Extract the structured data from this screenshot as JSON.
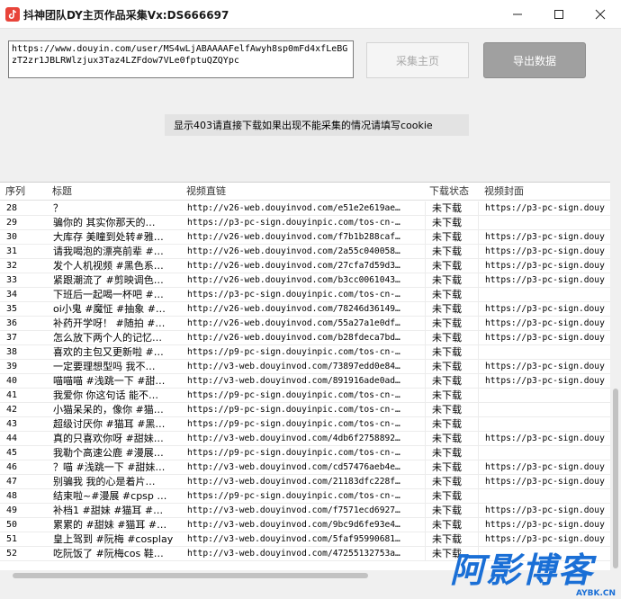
{
  "window": {
    "title": "抖神团队DY主页作品采集Vx:DS666697",
    "icon": "app-logo-icon"
  },
  "controls": {
    "url_value": "https://www.douyin.com/user/MS4wLjABAAAAFelfAwyh8sp0mFd4xfLeBGzT2zr1JBLRWlzjux3Taz4LZFdow7VLe0fptuQZQYpc",
    "collect_button": "采集主页",
    "export_button": "导出数据",
    "notice": "显示403请直接下载如果出现不能采集的情况请填写cookie"
  },
  "table": {
    "columns": [
      "序列",
      "标题",
      "视频直链",
      "下载状态",
      "视频封面"
    ],
    "rows": [
      {
        "idx": "28",
        "title": "？",
        "link": "http://v26-web.douyinvod.com/e51e2e619ae…",
        "status": "未下载",
        "cover": "https://p3-pc-sign.douy"
      },
      {
        "idx": "29",
        "title": "骗你的 其实你那天的…",
        "link": "https://p3-pc-sign.douyinpic.com/tos-cn-…",
        "status": "未下载",
        "cover": ""
      },
      {
        "idx": "30",
        "title": "大库存 美瞳到处转#雅…",
        "link": "http://v26-web.douyinvod.com/f7b1b288caf…",
        "status": "未下载",
        "cover": "https://p3-pc-sign.douy"
      },
      {
        "idx": "31",
        "title": "请我喝泡的漂亮前辈 #…",
        "link": "http://v26-web.douyinvod.com/2a55c040058…",
        "status": "未下载",
        "cover": "https://p3-pc-sign.douy"
      },
      {
        "idx": "32",
        "title": "发个人机视频 #黑色系…",
        "link": "http://v26-web.douyinvod.com/27cfa7d59d3…",
        "status": "未下载",
        "cover": "https://p3-pc-sign.douy"
      },
      {
        "idx": "33",
        "title": "紧跟潮流了 #剪映调色…",
        "link": "http://v26-web.douyinvod.com/b3cc0061043…",
        "status": "未下载",
        "cover": "https://p3-pc-sign.douy"
      },
      {
        "idx": "34",
        "title": "下班后一起喝一杯吧 #…",
        "link": "https://p3-pc-sign.douyinpic.com/tos-cn-…",
        "status": "未下载",
        "cover": ""
      },
      {
        "idx": "35",
        "title": "oi小鬼 #魔怔 #抽象 #…",
        "link": "http://v26-web.douyinvod.com/78246d36149…",
        "status": "未下载",
        "cover": "https://p3-pc-sign.douy"
      },
      {
        "idx": "36",
        "title": "补药开学呀！ #随拍 #…",
        "link": "http://v26-web.douyinvod.com/55a27a1e0df…",
        "status": "未下载",
        "cover": "https://p3-pc-sign.douy"
      },
      {
        "idx": "37",
        "title": "怎么放下两个人的记忆…",
        "link": "http://v26-web.douyinvod.com/b28fdeca7bd…",
        "status": "未下载",
        "cover": "https://p3-pc-sign.douy"
      },
      {
        "idx": "38",
        "title": "喜欢的主包又更新啦 #…",
        "link": "https://p9-pc-sign.douyinpic.com/tos-cn-…",
        "status": "未下载",
        "cover": ""
      },
      {
        "idx": "39",
        "title": "一定要理想型吗 我不…",
        "link": "http://v3-web.douyinvod.com/73897edd0e84…",
        "status": "未下载",
        "cover": "https://p3-pc-sign.douy"
      },
      {
        "idx": "40",
        "title": "喵喵喵 #浅跳一下 #甜…",
        "link": "http://v3-web.douyinvod.com/891916ade0ad…",
        "status": "未下载",
        "cover": "https://p3-pc-sign.douy"
      },
      {
        "idx": "41",
        "title": "我爱你 你这句话 能不…",
        "link": "https://p9-pc-sign.douyinpic.com/tos-cn-…",
        "status": "未下载",
        "cover": ""
      },
      {
        "idx": "42",
        "title": "小猫呆呆的，像你 #猫…",
        "link": "https://p9-pc-sign.douyinpic.com/tos-cn-…",
        "status": "未下载",
        "cover": ""
      },
      {
        "idx": "43",
        "title": "超级讨厌你 #猫耳 #黑…",
        "link": "https://p9-pc-sign.douyinpic.com/tos-cn-…",
        "status": "未下载",
        "cover": ""
      },
      {
        "idx": "44",
        "title": "真的只喜欢你呀 #甜妹…",
        "link": "http://v3-web.douyinvod.com/4db6f2758892…",
        "status": "未下载",
        "cover": "https://p3-pc-sign.douy"
      },
      {
        "idx": "45",
        "title": "我勒个高速公鹿 #漫展…",
        "link": "https://p9-pc-sign.douyinpic.com/tos-cn-…",
        "status": "未下载",
        "cover": ""
      },
      {
        "idx": "46",
        "title": "？喵 #浅跳一下 #甜妹…",
        "link": "http://v3-web.douyinvod.com/cd57476aeb4e…",
        "status": "未下载",
        "cover": "https://p3-pc-sign.douy"
      },
      {
        "idx": "47",
        "title": "别骗我 我的心是着片…",
        "link": "http://v3-web.douyinvod.com/21183dfc228f…",
        "status": "未下载",
        "cover": "https://p3-pc-sign.douy"
      },
      {
        "idx": "48",
        "title": "结束啦~#漫展 #cpsp …",
        "link": "https://p9-pc-sign.douyinpic.com/tos-cn-…",
        "status": "未下载",
        "cover": ""
      },
      {
        "idx": "49",
        "title": "补档1 #甜妹 #猫耳 #…",
        "link": "http://v3-web.douyinvod.com/f7571ecd6927…",
        "status": "未下载",
        "cover": "https://p3-pc-sign.douy"
      },
      {
        "idx": "50",
        "title": "累累的 #甜妹 #猫耳 #…",
        "link": "http://v3-web.douyinvod.com/9bc9d6fe93e4…",
        "status": "未下载",
        "cover": "https://p3-pc-sign.douy"
      },
      {
        "idx": "51",
        "title": "皇上驾到 #阮梅 #cosplay",
        "link": "http://v3-web.douyinvod.com/5faf95990681…",
        "status": "未下载",
        "cover": "https://p3-pc-sign.douy"
      },
      {
        "idx": "52",
        "title": "吃阮饭了 #阮梅cos 鞋…",
        "link": "http://v3-web.douyinvod.com/47255132753a…",
        "status": "未下载",
        "cover": ""
      }
    ]
  },
  "watermark": {
    "main": "阿影博客",
    "sub": "AYBK.CN",
    "color": "#1a6fd6"
  },
  "colors": {
    "icon_red": "#e8443a",
    "export_button_bg": "#a0a0a0"
  }
}
